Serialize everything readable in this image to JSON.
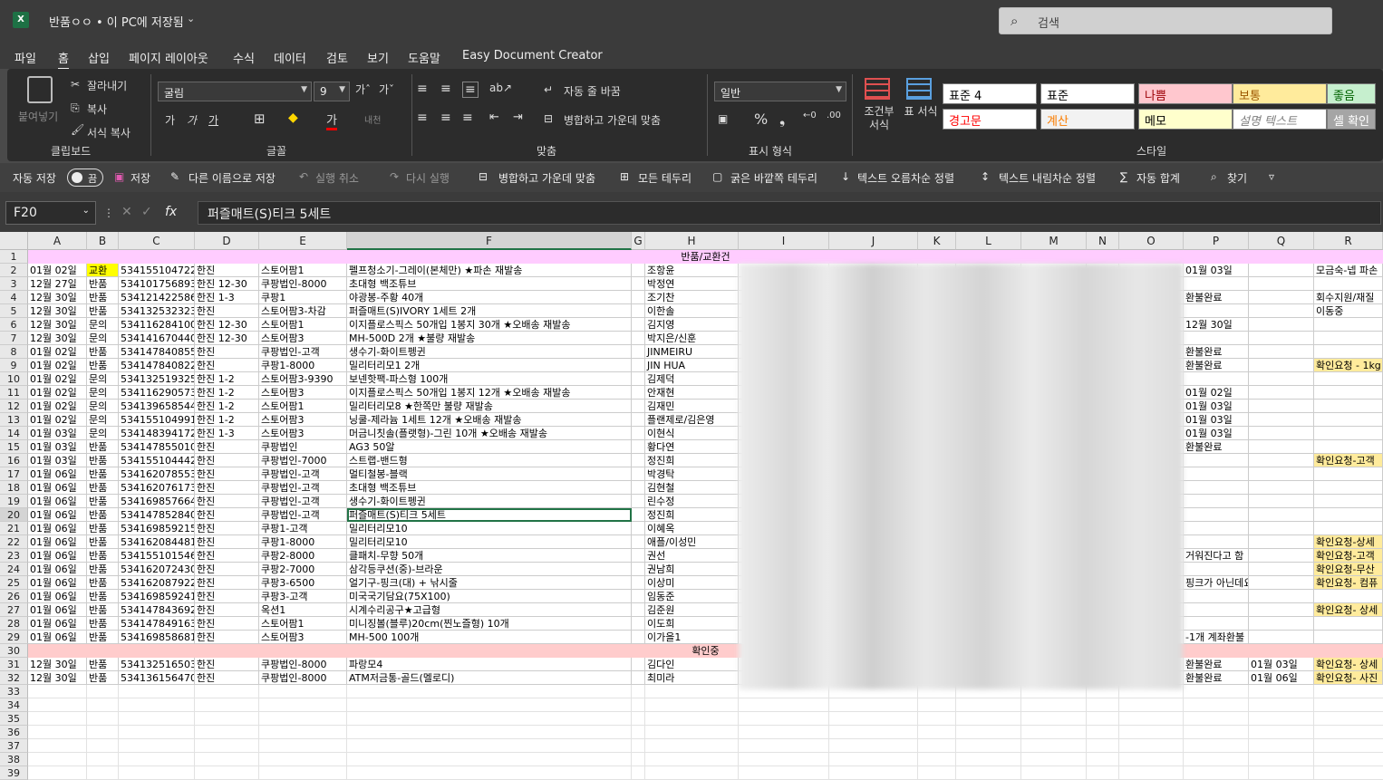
{
  "title": {
    "app_logo": "X",
    "doc_title": "반품ㅇㅇ • 이 PC에 저장됨",
    "search_placeholder": "검색"
  },
  "menu": [
    "파일",
    "홈",
    "삽입",
    "페이지 레이아웃",
    "수식",
    "데이터",
    "검토",
    "보기",
    "도움말",
    "Easy Document Creator"
  ],
  "ribbon": {
    "clipboard": {
      "paste": "붙여넣기",
      "cut": "잘라내기",
      "copy": "복사",
      "format_painter": "서식 복사",
      "label": "클립보드"
    },
    "font": {
      "name": "굴림",
      "size": "9",
      "label": "글꼴"
    },
    "align": {
      "wrap": "자동 줄 바꿈",
      "merge": "병합하고 가운데 맞춤",
      "label": "맞춤"
    },
    "number": {
      "format": "일반",
      "label": "표시 형식"
    },
    "styles": {
      "conditional": "조건부 서식",
      "table": "표 서식",
      "label": "스타일",
      "cells": [
        {
          "text": "표준 4",
          "bg": "#ffffff",
          "fg": "#000000"
        },
        {
          "text": "표준",
          "bg": "#ffffff",
          "fg": "#000000"
        },
        {
          "text": "나쁨",
          "bg": "#ffc7ce",
          "fg": "#9c0006"
        },
        {
          "text": "보통",
          "bg": "#ffeb9c",
          "fg": "#9c5700"
        },
        {
          "text": "좋음",
          "bg": "#c6efce",
          "fg": "#006100"
        },
        {
          "text": "경고문",
          "bg": "#ffffff",
          "fg": "#ff0000"
        },
        {
          "text": "계산",
          "bg": "#f2f2f2",
          "fg": "#fa7d00"
        },
        {
          "text": "메모",
          "bg": "#ffffcc",
          "fg": "#000000"
        },
        {
          "text": "설명 텍스트",
          "bg": "#ffffff",
          "fg": "#7f7f7f"
        },
        {
          "text": "셀 확인",
          "bg": "#a5a5a5",
          "fg": "#ffffff"
        }
      ]
    }
  },
  "qat": {
    "autosave": "자동 저장",
    "toggle": "끔",
    "save": "저장",
    "save_as": "다른 이름으로 저장",
    "undo": "실행 취소",
    "redo": "다시 실행",
    "merge": "병합하고 가운데 맞춤",
    "all_borders": "모든 테두리",
    "thick_border": "굵은 바깥쪽 테두리",
    "sort_asc": "텍스트 오름차순 정렬",
    "sort_desc": "텍스트 내림차순 정렬",
    "autosum": "자동 합계",
    "find": "찾기"
  },
  "formula": {
    "namebox": "F20",
    "fx": "fx",
    "content": "퍼즐매트(S)티크 5세트"
  },
  "columns": [
    "A",
    "B",
    "C",
    "D",
    "E",
    "F",
    "G",
    "H",
    "I",
    "J",
    "K",
    "L",
    "M",
    "N",
    "O",
    "P",
    "Q",
    "R"
  ],
  "row_numbers": [
    "1",
    "2",
    "3",
    "4",
    "5",
    "6",
    "7",
    "8",
    "9",
    "10",
    "11",
    "12",
    "13",
    "14",
    "15",
    "16",
    "17",
    "18",
    "19",
    "20",
    "21",
    "22",
    "23",
    "24",
    "25",
    "26",
    "27",
    "28",
    "29",
    "30",
    "31",
    "32",
    "33",
    "34",
    "35",
    "36",
    "37",
    "38",
    "39"
  ],
  "bands": {
    "row1": "반품/교환건",
    "row30": "확인중",
    "colors": {
      "row1": "#ffccff",
      "row30": "#ffcccc"
    }
  },
  "rows": [
    {
      "r": 2,
      "c": [
        "01월 02일",
        "교환",
        "534155104722",
        "한진",
        "스토어팜1",
        "펠프청소기-그레이(본체만) ★파손 재발송",
        "",
        "조항윤"
      ],
      "p": "01월 03일",
      "q": "",
      "rr": "모금숙-넵 파손"
    },
    {
      "r": 3,
      "c": [
        "12월 27일",
        "반품",
        "534101756893",
        "한진 12-30",
        "쿠팡법인-8000",
        "초대형 백조튜브",
        "",
        "박정연"
      ],
      "p": "",
      "q": "",
      "rr": ""
    },
    {
      "r": 4,
      "c": [
        "12월 30일",
        "반품",
        "534121422586",
        "한진 1-3",
        "쿠팡1",
        "야광봉-주황 40개",
        "",
        "조기찬"
      ],
      "p": "환불완료",
      "q": "",
      "rr": "회수지원/재질"
    },
    {
      "r": 5,
      "c": [
        "12월 30일",
        "반품",
        "534132532323",
        "한진",
        "스토어팜3-차감",
        "퍼즐매트(S)IVORY 1세트 2개",
        "",
        "이한솔"
      ],
      "p": "",
      "q": "",
      "rr": "이동중"
    },
    {
      "r": 6,
      "c": [
        "12월 30일",
        "문의",
        "534116284100",
        "한진 12-30",
        "스토어팜1",
        "이지플로스픽스 50개입 1봉지 30개 ★오배송 재발송",
        "",
        "김지영"
      ],
      "p": "12월 30일",
      "q": "",
      "rr": ""
    },
    {
      "r": 7,
      "c": [
        "12월 30일",
        "문의",
        "534141670440",
        "한진 12-30",
        "스토어팜3",
        "MH-500D 2개 ★불량 재발송",
        "",
        "박지은/신훈"
      ],
      "p": "",
      "q": "",
      "rr": ""
    },
    {
      "r": 8,
      "c": [
        "01월 02일",
        "반품",
        "534147840855",
        "한진",
        "쿠팡법인-고객",
        "생수기-화이트펭귄",
        "",
        "JINMEIRU"
      ],
      "p": "환불완료",
      "q": "",
      "rr": ""
    },
    {
      "r": 9,
      "c": [
        "01월 02일",
        "반품",
        "534147840822",
        "한진",
        "쿠팡1-8000",
        "밀리터리모1 2개",
        "",
        "JIN HUA"
      ],
      "p": "환불완료",
      "q": "",
      "rr": "확인요청 - 1kg"
    },
    {
      "r": 10,
      "c": [
        "01월 02일",
        "문의",
        "534132519325",
        "한진 1-2",
        "스토어팜3-9390",
        "보넨핫팩-파스형 100개",
        "",
        "김제덕"
      ],
      "p": "",
      "q": "",
      "rr": ""
    },
    {
      "r": 11,
      "c": [
        "01월 02일",
        "문의",
        "534116290573",
        "한진 1-2",
        "스토어팜3",
        "이지플로스픽스 50개입 1봉지 12개 ★오배송 재발송",
        "",
        "안재현"
      ],
      "p": "01월 02일",
      "q": "",
      "rr": ""
    },
    {
      "r": 12,
      "c": [
        "01월 02일",
        "문의",
        "534139658544",
        "한진 1-2",
        "스토어팜1",
        "밀리터리모8 ★한쪽만 불량 재발송",
        "",
        "김재민"
      ],
      "p": "01월 03일",
      "q": "",
      "rr": ""
    },
    {
      "r": 13,
      "c": [
        "01월 02일",
        "문의",
        "534155104991",
        "한진 1-2",
        "스토어팜3",
        "닝쿨-제라늄 1세트 12개 ★오배송 재발송",
        "",
        "플랜제로/김은영"
      ],
      "p": "01월 03일",
      "q": "",
      "rr": ""
    },
    {
      "r": 14,
      "c": [
        "01월 03일",
        "문의",
        "534148394172",
        "한진 1-3",
        "스토어팜3",
        "머금니칫솔(플랫형)-그린 10개 ★오배송 재발송",
        "",
        "이현식"
      ],
      "p": "01월 03일",
      "q": "",
      "rr": ""
    },
    {
      "r": 15,
      "c": [
        "01월 03일",
        "반품",
        "534147855010",
        "한진",
        "쿠팡법인",
        "AG3 50알",
        "",
        "황다연"
      ],
      "p": "환불완료",
      "q": "",
      "rr": ""
    },
    {
      "r": 16,
      "c": [
        "01월 03일",
        "반품",
        "534155104442",
        "한진",
        "쿠팡법인-7000",
        "스트랩-밴드형",
        "",
        "정진희"
      ],
      "p": "",
      "q": "",
      "rr": "확인요청-고객"
    },
    {
      "r": 17,
      "c": [
        "01월 06일",
        "반품",
        "534162078553",
        "한진",
        "쿠팡법인-고객",
        "멀티철봉-블랙",
        "",
        "박경탁"
      ],
      "p": "",
      "q": "",
      "rr": ""
    },
    {
      "r": 18,
      "c": [
        "01월 06일",
        "반품",
        "534162076173",
        "한진",
        "쿠팡법인-고객",
        "초대형 백조튜브",
        "",
        "김현철"
      ],
      "p": "",
      "q": "",
      "rr": ""
    },
    {
      "r": 19,
      "c": [
        "01월 06일",
        "반품",
        "534169857664",
        "한진",
        "쿠팡법인-고객",
        "생수기-화이트펭귄",
        "",
        "린수정"
      ],
      "p": "",
      "q": "",
      "rr": ""
    },
    {
      "r": 20,
      "c": [
        "01월 06일",
        "반품",
        "534147852840",
        "한진",
        "쿠팡법인-고객",
        "퍼즐매트(S)티크 5세트",
        "",
        "정진희"
      ],
      "p": "",
      "q": "",
      "rr": ""
    },
    {
      "r": 21,
      "c": [
        "01월 06일",
        "반품",
        "534169859215",
        "한진",
        "쿠팡1-고객",
        "밀리터리모10",
        "",
        "이혜옥"
      ],
      "p": "",
      "q": "",
      "rr": ""
    },
    {
      "r": 22,
      "c": [
        "01월 06일",
        "반품",
        "534162084481",
        "한진",
        "쿠팡1-8000",
        "밀리터리모10",
        "",
        "애플/이성민"
      ],
      "p": "",
      "q": "",
      "rr": "확인요청-상세"
    },
    {
      "r": 23,
      "c": [
        "01월 06일",
        "반품",
        "534155101546",
        "한진",
        "쿠팡2-8000",
        "클패치-무향 50개",
        "",
        "권선"
      ],
      "p": "거워진다고 함",
      "q": "",
      "rr": "확인요청-고객"
    },
    {
      "r": 24,
      "c": [
        "01월 06일",
        "반품",
        "534162072430",
        "한진",
        "쿠팡2-7000",
        "삼각등쿠션(중)-브라운",
        "",
        "권남희"
      ],
      "p": "",
      "q": "",
      "rr": "확인요청-무산"
    },
    {
      "r": 25,
      "c": [
        "01월 06일",
        "반품",
        "534162087922",
        "한진",
        "쿠팡3-6500",
        "얼기구-핑크(대) + 낚시줄",
        "",
        "이상미"
      ],
      "p": "핑크가 아닌데요",
      "q": "",
      "rr": "확인요청- 컴퓨"
    },
    {
      "r": 26,
      "c": [
        "01월 06일",
        "반품",
        "534169859241",
        "한진",
        "쿠팡3-고객",
        "미국국기담요(75X100)",
        "",
        "임동준"
      ],
      "p": "",
      "q": "",
      "rr": ""
    },
    {
      "r": 27,
      "c": [
        "01월 06일",
        "반품",
        "534147843692",
        "한진",
        "옥션1",
        "시계수리공구★고급형",
        "",
        "김준원"
      ],
      "p": "",
      "q": "",
      "rr": "확인요청- 상세"
    },
    {
      "r": 28,
      "c": [
        "01월 06일",
        "반품",
        "534147849163",
        "한진",
        "스토어팜1",
        "미니징볼(블루)20cm(찐노즐형) 10개",
        "",
        "이도희"
      ],
      "p": "",
      "q": "",
      "rr": ""
    },
    {
      "r": 29,
      "c": [
        "01월 06일",
        "반품",
        "534169858681",
        "한진",
        "스토어팜3",
        "MH-500 100개",
        "",
        "이가을1"
      ],
      "p": "-1개 계좌환불",
      "q": "",
      "rr": ""
    },
    {
      "r": 31,
      "c": [
        "12월 30일",
        "반품",
        "534132516503",
        "한진",
        "쿠팡법인-8000",
        "파랑모4",
        "",
        "김다인"
      ],
      "p": "환불완료",
      "q": "01월 03일",
      "rr": "확인요청- 상세"
    },
    {
      "r": 32,
      "c": [
        "12월 30일",
        "반품",
        "534136156470",
        "한진",
        "쿠팡법인-8000",
        "ATM저금통-골드(멜로디)",
        "",
        "최미라"
      ],
      "p": "환불완료",
      "q": "01월 06일",
      "rr": "확인요청- 사진"
    }
  ]
}
